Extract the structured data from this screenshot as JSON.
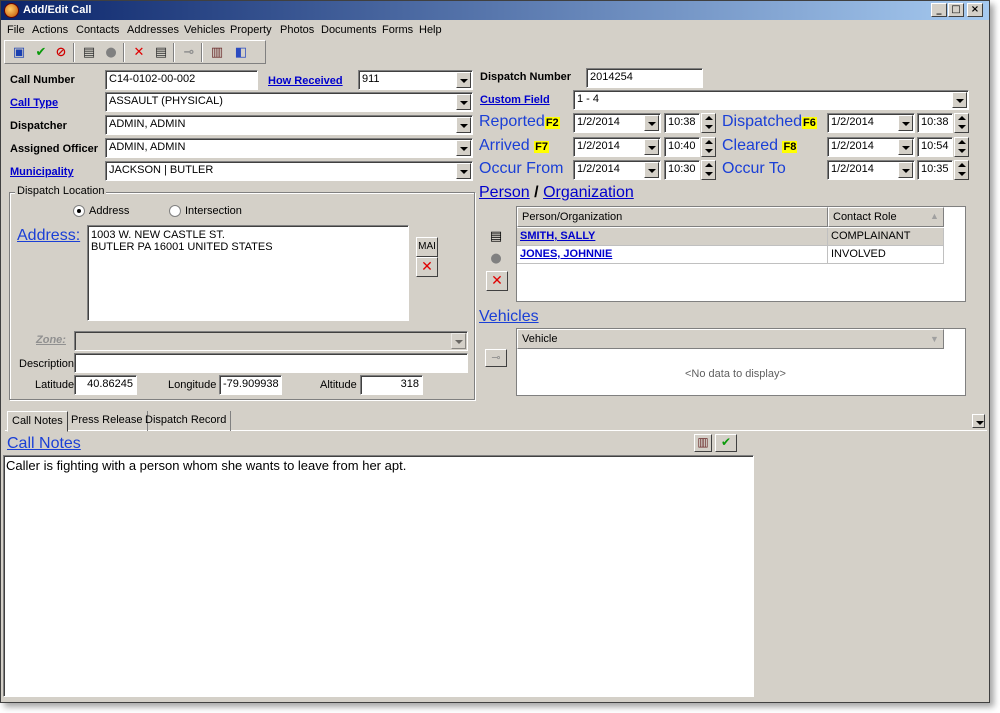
{
  "window": {
    "title": "Add/Edit Call",
    "minimize": "_",
    "maximize": "□",
    "close": "×"
  },
  "menu": [
    "File",
    "Actions",
    "Contacts",
    "Addresses",
    "Vehicles",
    "Property",
    "Photos",
    "Documents",
    "Forms",
    "Help"
  ],
  "form": {
    "call_number_label": "Call Number",
    "call_number": "C14-0102-00-002",
    "how_received_label": "How Received",
    "how_received": "911",
    "dispatch_number_label": "Dispatch Number",
    "dispatch_number": "2014254",
    "call_type_label": "Call Type",
    "call_type": "ASSAULT (PHYSICAL)",
    "custom_field_label": "Custom Field",
    "custom_field": "1 - 4",
    "dispatcher_label": "Dispatcher",
    "dispatcher": "ADMIN, ADMIN",
    "assigned_officer_label": "Assigned Officer",
    "assigned_officer": "ADMIN, ADMIN",
    "municipality_label": "Municipality",
    "municipality": "JACKSON | BUTLER"
  },
  "times": {
    "reported": {
      "label": "Reported",
      "key": "F2",
      "date": "1/2/2014",
      "time": "10:38"
    },
    "dispatched": {
      "label": "Dispatched",
      "key": "F6",
      "date": "1/2/2014",
      "time": "10:38"
    },
    "arrived": {
      "label": "Arrived",
      "key": "F7",
      "date": "1/2/2014",
      "time": "10:40"
    },
    "cleared": {
      "label": "Cleared",
      "key": "F8",
      "date": "1/2/2014",
      "time": "10:54"
    },
    "occur_from": {
      "label": "Occur From",
      "date": "1/2/2014",
      "time": "10:30"
    },
    "occur_to": {
      "label": "Occur To",
      "date": "1/2/2014",
      "time": "10:35"
    }
  },
  "location": {
    "group_title": "Dispatch Location",
    "radio_address": "Address",
    "radio_intersection": "Intersection",
    "address_label": "Address:",
    "address": "1003 W. NEW CASTLE ST.\nBUTLER PA 16001 UNITED STATES",
    "map_button": "MAI",
    "zone_label": "Zone:",
    "zone": "",
    "description_label": "Description",
    "description": "",
    "latitude_label": "Latitude",
    "latitude": "40.86245",
    "longitude_label": "Longitude",
    "longitude": "-79.909938",
    "altitude_label": "Altitude",
    "altitude": "318"
  },
  "persons": {
    "title_person": "Person",
    "title_sep": "/",
    "title_org": "Organization",
    "columns": [
      "Person/Organization",
      "Contact Role"
    ],
    "rows": [
      {
        "name": "SMITH, SALLY",
        "role": "COMPLAINANT"
      },
      {
        "name": "JONES, JOHNNIE",
        "role": "INVOLVED"
      }
    ]
  },
  "vehicles": {
    "title": "Vehicles",
    "column": "Vehicle",
    "empty": "<No data to display>"
  },
  "tabs": [
    "Call Notes",
    "Press Release",
    "Dispatch Record"
  ],
  "notes": {
    "title": "Call Notes",
    "text": "Caller is fighting with a person whom she wants to leave from her apt."
  },
  "colors": {
    "link": "#0000cc",
    "big_label": "#1a3fd6",
    "fkey": "#ffff00",
    "title_bar": "#0a246a"
  }
}
